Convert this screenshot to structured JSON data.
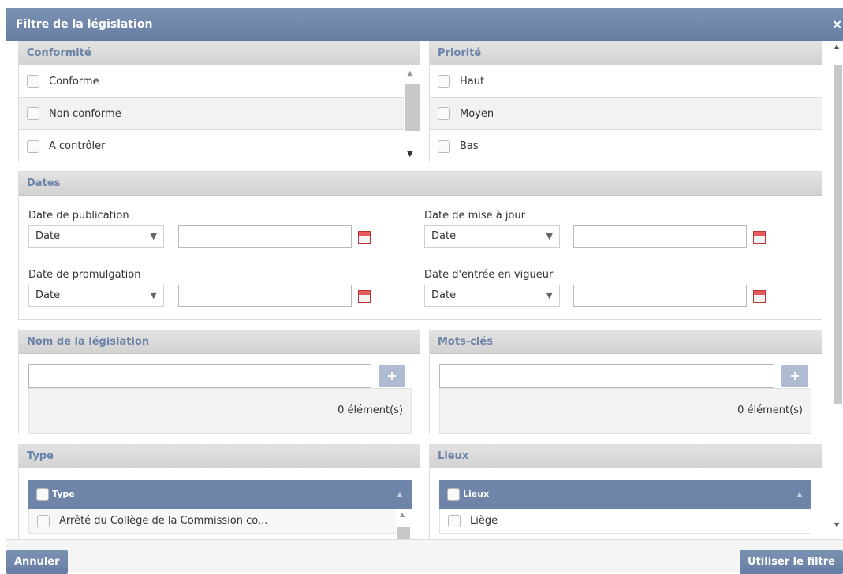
{
  "dialog": {
    "title": "Filtre de la législation",
    "close_icon": "×"
  },
  "conformite": {
    "title": "Conformité",
    "items": [
      "Conforme",
      "Non conforme",
      "A contrôler"
    ]
  },
  "priorite": {
    "title": "Priorité",
    "items": [
      "Haut",
      "Moyen",
      "Bas"
    ]
  },
  "dates": {
    "title": "Dates",
    "publication": {
      "label": "Date de publication",
      "select": "Date"
    },
    "mise_a_jour": {
      "label": "Date de mise à jour",
      "select": "Date"
    },
    "promulgation": {
      "label": "Date de promulgation",
      "select": "Date"
    },
    "entree_vigueur": {
      "label": "Date d'entrée en vigueur",
      "select": "Date"
    }
  },
  "nom": {
    "title": "Nom de la législation",
    "count": "0 élément(s)",
    "add": "+"
  },
  "motscles": {
    "title": "Mots-clés",
    "count": "0 élément(s)",
    "add": "+"
  },
  "type": {
    "title": "Type",
    "header": "Type",
    "rows": [
      "Arrêté du Collège de la Commission co..."
    ]
  },
  "lieux": {
    "title": "Lieux",
    "header": "Lieux",
    "rows": [
      "Liège"
    ]
  },
  "footer": {
    "cancel": "Annuler",
    "apply": "Utiliser le filtre"
  },
  "colors": {
    "accent": "#6e84a8",
    "header_text": "#6d84a8"
  }
}
